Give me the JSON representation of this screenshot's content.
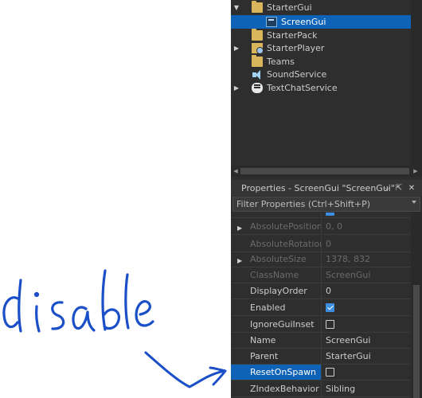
{
  "annotation": {
    "handwritten_text": "disable",
    "ink_color": "#1a4fc7"
  },
  "colors": {
    "panel_bg": "#2e2e2e",
    "selection": "#0f63b6",
    "folder": "#d9b65b",
    "checkbox_accent": "#3c8fe0"
  },
  "explorer": {
    "items": [
      {
        "label": "StarterGui",
        "icon": "folder-gui-icon",
        "expanded": true
      },
      {
        "label": "ScreenGui",
        "icon": "screengui-icon",
        "selected": true
      },
      {
        "label": "StarterPack",
        "icon": "folder-pack-icon"
      },
      {
        "label": "StarterPlayer",
        "icon": "folder-player-icon",
        "collapsed": true
      },
      {
        "label": "Teams",
        "icon": "folder-teams-icon"
      },
      {
        "label": "SoundService",
        "icon": "sound-icon"
      },
      {
        "label": "TextChatService",
        "icon": "chat-icon",
        "collapsed": true
      }
    ]
  },
  "properties": {
    "title": "Properties - ScreenGui \"ScreenGui\"",
    "filter_placeholder": "Filter Properties (Ctrl+Shift+P)",
    "rows": [
      {
        "name": "AbsolutePosition",
        "value": "0, 0",
        "readonly": true
      },
      {
        "name": "AbsoluteRotation",
        "value": "0",
        "readonly": true
      },
      {
        "name": "AbsoluteSize",
        "value": "1378, 832",
        "readonly": true
      },
      {
        "name": "ClassName",
        "value": "ScreenGui",
        "readonly": true
      },
      {
        "name": "DisplayOrder",
        "value": "0"
      },
      {
        "name": "Enabled",
        "checked": true
      },
      {
        "name": "IgnoreGuiInset",
        "checked": false
      },
      {
        "name": "Name",
        "value": "ScreenGui"
      },
      {
        "name": "Parent",
        "value": "StarterGui"
      },
      {
        "name": "ResetOnSpawn",
        "checked": false,
        "selected": true
      },
      {
        "name": "ZIndexBehavior",
        "value": "Sibling"
      }
    ]
  }
}
